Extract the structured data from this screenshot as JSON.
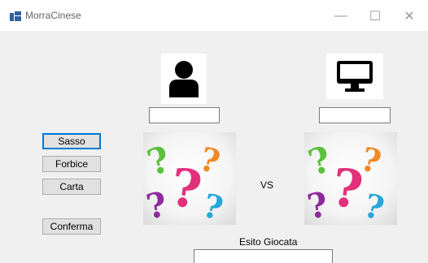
{
  "window": {
    "title": "MorraCinese",
    "minimize_symbol": "—",
    "maximize_symbol": "☐",
    "close_symbol": "✕"
  },
  "player": {
    "icon": "user-icon",
    "name_value": ""
  },
  "computer": {
    "icon": "monitor-icon",
    "name_value": ""
  },
  "buttons": {
    "sasso": "Sasso",
    "forbice": "Forbice",
    "carta": "Carta",
    "conferma": "Conferma"
  },
  "vs_label": "VS",
  "esito": {
    "label": "Esito Giocata",
    "value": ""
  },
  "images": {
    "player_choice": "question-marks-image",
    "computer_choice": "question-marks-image"
  },
  "colors": {
    "window_bg": "#f0f0f0",
    "titlebar_bg": "#ffffff",
    "focus_border": "#0078d7",
    "button_bg": "#e1e1e1"
  }
}
